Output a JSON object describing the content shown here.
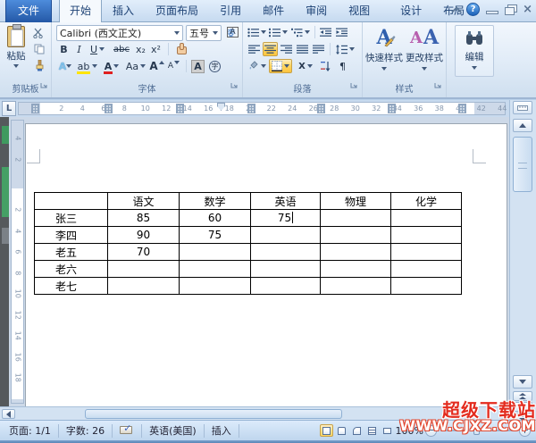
{
  "titlebar": {
    "tabs": [
      "文件",
      "开始",
      "插入",
      "页面布局",
      "引用",
      "邮件",
      "审阅",
      "视图",
      "设计",
      "布局"
    ],
    "active_tab": "开始",
    "controls": {
      "help_glyph": "?",
      "close_glyph": "×"
    }
  },
  "ribbon": {
    "clipboard": {
      "group_label": "剪贴板",
      "paste_label": "粘贴"
    },
    "font": {
      "group_label": "字体",
      "name_value": "Calibri (西文正文)",
      "size_value": "五号",
      "glyphs": {
        "bold": "B",
        "italic": "I",
        "underline": "U",
        "strike": "abc",
        "sub": "x₂",
        "sup": "x²",
        "phonetic": "变",
        "char_border": "A",
        "effects": "A",
        "highlight": "ab",
        "color": "A",
        "case": "Aa",
        "grow": "A",
        "shrink": "A",
        "char_shading": "A",
        "enclose": "字"
      }
    },
    "paragraph": {
      "group_label": "段落",
      "glyphs": {
        "asian": "X",
        "pilcrow": "¶"
      }
    },
    "styles": {
      "group_label": "样式",
      "quick_label": "快速样式",
      "change_label": "更改样式",
      "glyphs": {
        "quick": "A",
        "change1": "A",
        "change2": "A"
      }
    },
    "editing": {
      "label": "编辑"
    }
  },
  "ruler": {
    "tab_selector": "L",
    "numbers": [
      "2",
      "4",
      "6",
      "8",
      "10",
      "12",
      "14",
      "16",
      "18",
      "20",
      "22",
      "24",
      "26",
      "28",
      "30",
      "32",
      "34",
      "36",
      "38",
      "40",
      "42",
      "44"
    ],
    "v_margin_numbers": [
      "4",
      "2"
    ],
    "v_numbers": [
      "2",
      "4",
      "6",
      "8",
      "10",
      "12",
      "14",
      "16",
      "18"
    ]
  },
  "document": {
    "table": {
      "headers": [
        "",
        "语文",
        "数学",
        "英语",
        "物理",
        "化学"
      ],
      "rows": [
        [
          "张三",
          "85",
          "60",
          "75",
          "",
          ""
        ],
        [
          "李四",
          "90",
          "75",
          "",
          "",
          ""
        ],
        [
          "老五",
          "70",
          "",
          "",
          "",
          ""
        ],
        [
          "老六",
          "",
          "",
          "",
          "",
          ""
        ],
        [
          "老七",
          "",
          "",
          "",
          "",
          ""
        ]
      ]
    }
  },
  "statusbar": {
    "page": "页面: 1/1",
    "words": "字数: 26",
    "spell_glyph": "✓",
    "language": "英语(美国)",
    "mode": "插入",
    "zoom_level": "100%"
  },
  "watermark": {
    "line1": "超级下载站",
    "line2": "WWW.CJXZ.COM"
  }
}
